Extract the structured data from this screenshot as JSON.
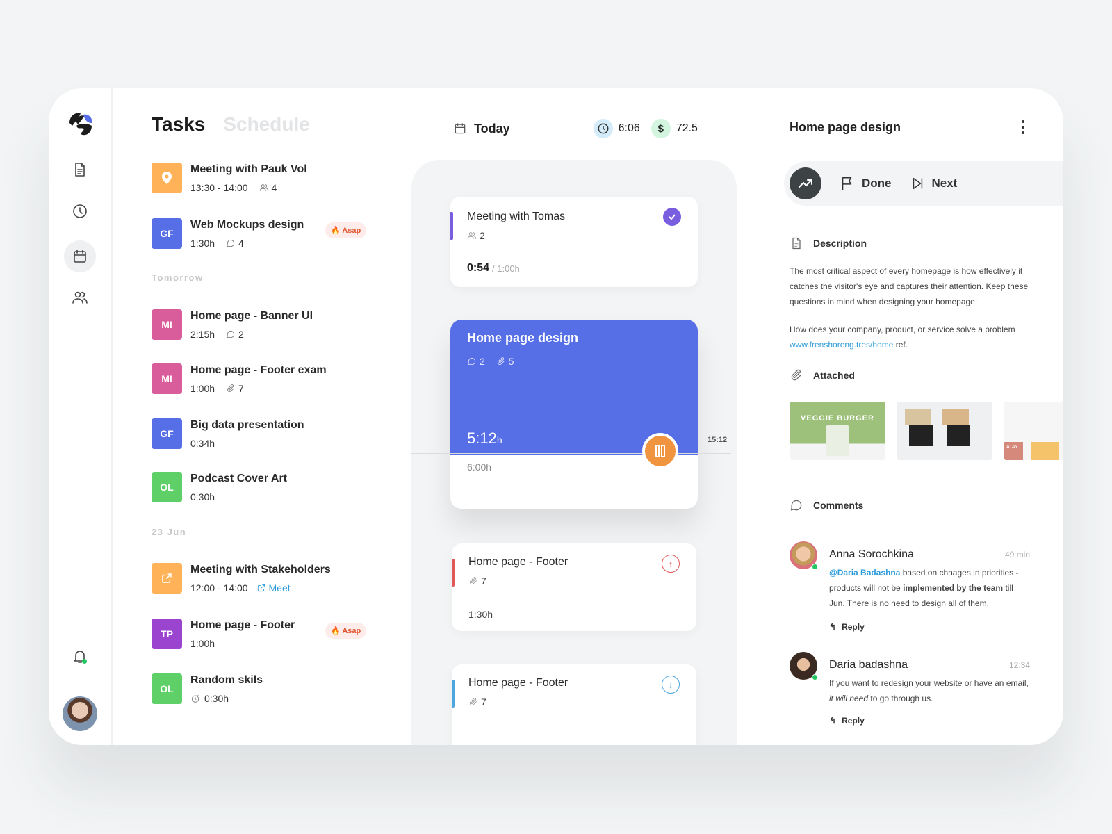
{
  "nav": {
    "items": [
      {
        "name": "documents",
        "icon": "document-icon",
        "active": false
      },
      {
        "name": "time",
        "icon": "clock-icon",
        "active": false
      },
      {
        "name": "calendar",
        "icon": "calendar-icon",
        "active": true
      },
      {
        "name": "team",
        "icon": "users-icon",
        "active": false
      }
    ],
    "notifications_icon": "bell-icon",
    "has_notification": true
  },
  "tasks_panel": {
    "tabs": [
      {
        "label": "Tasks",
        "active": true
      },
      {
        "label": "Schedule",
        "active": false
      }
    ],
    "sections": [
      "Tomorrow",
      "23 Jun"
    ],
    "tasks": [
      {
        "title": "Meeting with Pauk Vol",
        "badge": "",
        "badge_icon": "location-pin-icon",
        "color": "#ffb257",
        "meta": "13:30 - 14:00",
        "meta_icon": "users-icon",
        "meta_count": "4"
      },
      {
        "title": "Web Mockups design",
        "badge": "GF",
        "color": "#566ee6",
        "meta": "1:30h",
        "meta_icon": "comment-icon",
        "meta_count": "4",
        "tag": "Asap"
      },
      {
        "title": "Home page - Banner UI",
        "badge": "MI",
        "color": "#d95d9b",
        "meta": "2:15h",
        "meta_icon": "comment-icon",
        "meta_count": "2"
      },
      {
        "title": "Home page - Footer exam",
        "badge": "MI",
        "color": "#d95d9b",
        "meta": "1:00h",
        "meta_icon": "paperclip-icon",
        "meta_count": "7"
      },
      {
        "title": "Big data presentation",
        "badge": "GF",
        "color": "#566ee6",
        "meta": "0:34h"
      },
      {
        "title": "Podcast Cover Art",
        "badge": "OL",
        "color": "#5fd068",
        "meta": "0:30h"
      },
      {
        "title": "Meeting with Stakeholders",
        "badge": "",
        "badge_icon": "external-link-icon",
        "color": "#ffb257",
        "meta": "12:00 - 14:00",
        "link_label": "Meet"
      },
      {
        "title": "Home page - Footer",
        "badge": "TP",
        "color": "#9b44d0",
        "meta": "1:00h",
        "tag": "Asap"
      },
      {
        "title": "Random skils",
        "badge": "OL",
        "color": "#5fd068",
        "meta": "0:30h",
        "meta_icon": "timer-icon"
      }
    ]
  },
  "schedule": {
    "header": {
      "label": "Today",
      "time": "6:06",
      "money_symbol": "$",
      "money": "72.5"
    },
    "now_time": "15:12",
    "cards": [
      {
        "title": "Meeting with Tomas",
        "participants": "2",
        "elapsed": "0:54",
        "total": "/ 1:00h",
        "status": "done",
        "accent": "#7a5ee0"
      },
      {
        "title": "Home page design",
        "comments": "2",
        "attachments": "5",
        "elapsed": "5:12",
        "elapsed_unit": "h",
        "total": "6:00h",
        "progress": 0.87,
        "accent": "#566ee6"
      },
      {
        "title": "Home page - Footer",
        "attachments": "7",
        "duration": "1:30h",
        "priority": "up",
        "accent": "#e05a5a"
      },
      {
        "title": "Home page - Footer",
        "attachments": "7",
        "priority": "down",
        "accent": "#4da6e0"
      }
    ]
  },
  "detail": {
    "title": "Home page design",
    "actions": {
      "done": "Done",
      "next": "Next"
    },
    "description_label": "Description",
    "description_p1": "The most critical aspect of every homepage is how effectively it catches the visitor's eye and captures their attention. Keep these questions in mind when designing your homepage:",
    "description_p2": "How does your company, product, or service solve a problem",
    "link": "www.frenshoreng.tres/home",
    "link_suffix": " ref.",
    "attached_label": "Attached",
    "attachments": [
      {
        "caption": "VEGGIE BURGER"
      },
      {
        "caption": ""
      },
      {
        "caption": "ATAY"
      }
    ],
    "comments_label": "Comments",
    "comments": [
      {
        "name": "Anna Sorochkina",
        "time": "49 min",
        "mention": "@Daria Badashna",
        "text1": " based on chnages in priorities - products will not be ",
        "bold": "implemented by the team",
        "text2": " till Jun. There is no need to design all of them.",
        "reply": "Reply",
        "online": true
      },
      {
        "name": "Daria badashna",
        "time": "12:34",
        "text1": "If you want to redesign your website or have an email, ",
        "italic": "it will need",
        "text2": " to go through us.",
        "reply": "Reply",
        "online": true
      }
    ]
  }
}
